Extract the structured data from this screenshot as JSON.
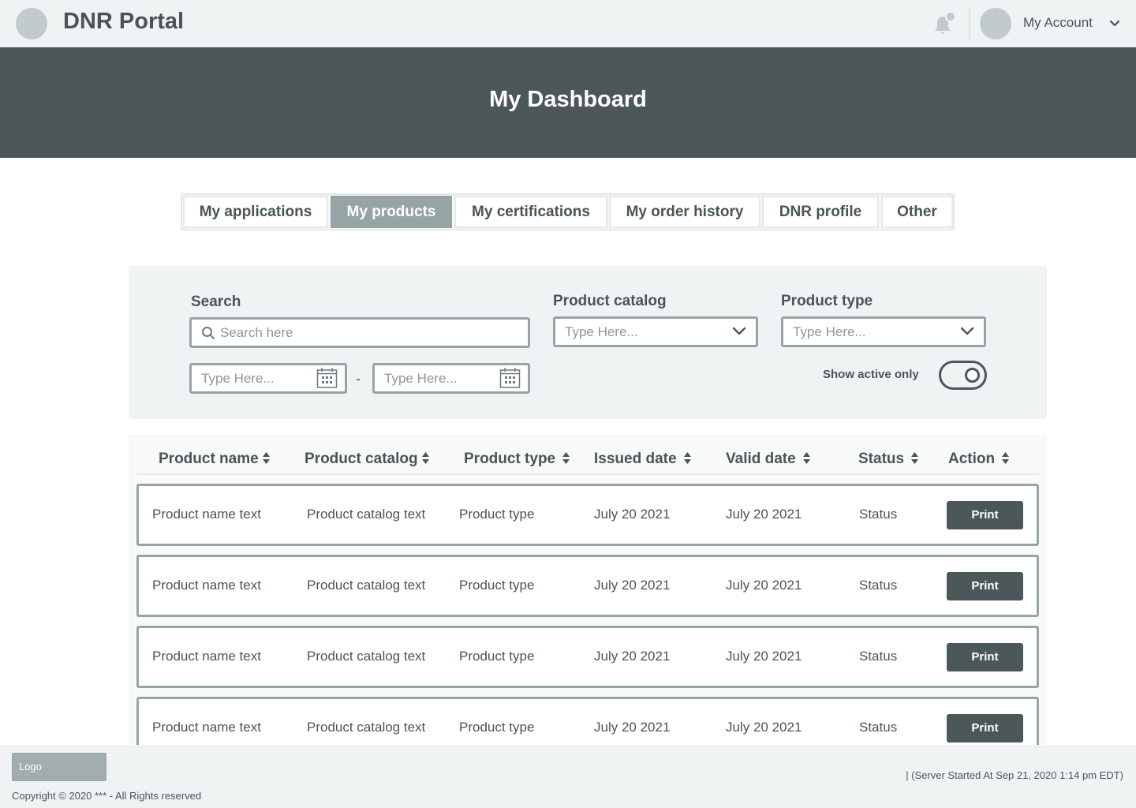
{
  "header": {
    "title": "DNR Portal",
    "account_label": "My Account"
  },
  "hero": {
    "title": "My Dashboard"
  },
  "tabs": [
    {
      "label": "My applications",
      "active": false
    },
    {
      "label": "My products",
      "active": true
    },
    {
      "label": "My certifications",
      "active": false
    },
    {
      "label": "My order history",
      "active": false
    },
    {
      "label": "DNR profile",
      "active": false
    },
    {
      "label": "Other",
      "active": false
    }
  ],
  "filters": {
    "search_label": "Search",
    "search_placeholder": "Search here",
    "catalog_label": "Product catalog",
    "catalog_placeholder": "Type Here...",
    "type_label": "Product type",
    "type_placeholder": "Type Here...",
    "date_from_placeholder": "Type Here...",
    "date_to_placeholder": "Type Here...",
    "date_separator": "-",
    "active_only_label": "Show active only",
    "active_only_on": true
  },
  "table": {
    "columns": [
      "Product name",
      "Product catalog",
      "Product type",
      "Issued date",
      "Valid date",
      "Status",
      "Action"
    ],
    "rows": [
      {
        "name": "Product name text",
        "catalog": "Product catalog text",
        "type": "Product type",
        "issued": "July 20 2021",
        "valid": "July 20 2021",
        "status": "Status",
        "action": "Print"
      },
      {
        "name": "Product name text",
        "catalog": "Product catalog text",
        "type": "Product type",
        "issued": "July 20 2021",
        "valid": "July 20 2021",
        "status": "Status",
        "action": "Print"
      },
      {
        "name": "Product name text",
        "catalog": "Product catalog text",
        "type": "Product type",
        "issued": "July 20 2021",
        "valid": "July 20 2021",
        "status": "Status",
        "action": "Print"
      },
      {
        "name": "Product name text",
        "catalog": "Product catalog text",
        "type": "Product type",
        "issued": "July 20 2021",
        "valid": "July 20 2021",
        "status": "Status",
        "action": "Print"
      }
    ]
  },
  "footer": {
    "logo_label": "Logo",
    "server_note": "| (Server Started At Sep 21, 2020 1:14 pm EDT)",
    "copyright": "Copyright © 2020 *** - All Rights reserved"
  },
  "colors": {
    "hero_bg": "#4c5759",
    "active_tab": "#97a4a6",
    "panel_bg": "#f0f3f4",
    "button_bg": "#4c5759"
  },
  "icons": [
    "bell-icon",
    "chevron-down-icon",
    "search-icon",
    "calendar-icon",
    "sort-icon"
  ]
}
